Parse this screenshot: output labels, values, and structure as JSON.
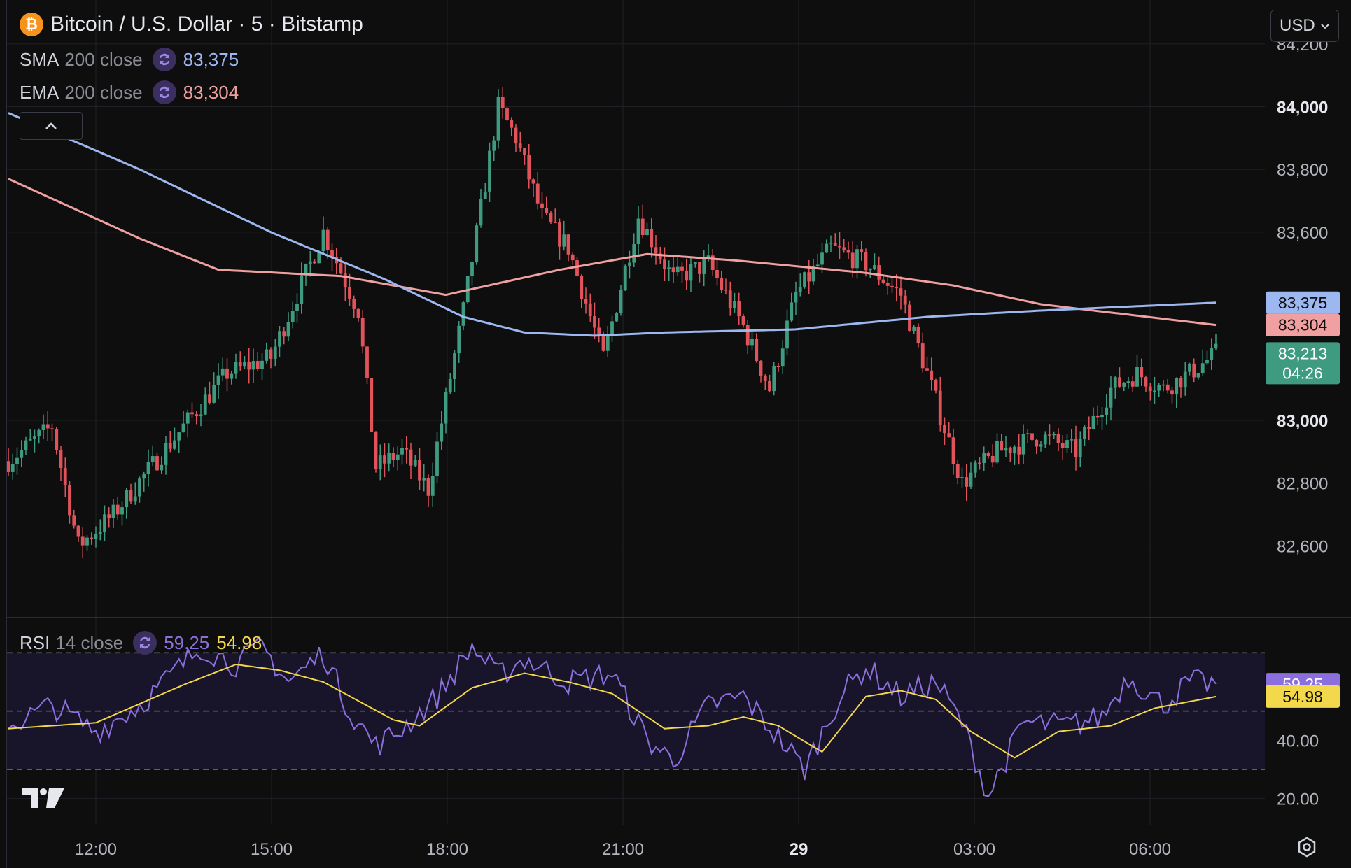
{
  "header": {
    "symbol_title": "Bitcoin / U.S. Dollar · 5 · Bitstamp",
    "btc_icon_glyph": "₿",
    "currency_label": "USD",
    "currency_icon": "chevron-down-icon"
  },
  "indicators": {
    "sma": {
      "name": "SMA",
      "params": "200 close",
      "value": "83,375",
      "color": "#9db8f0"
    },
    "ema": {
      "name": "EMA",
      "params": "200 close",
      "value": "83,304",
      "color": "#f0a0a0"
    },
    "rsi": {
      "name": "RSI",
      "params": "14 close",
      "value": "59.25",
      "ma_value": "54.98",
      "color": "#8b6fdc",
      "ma_color": "#f2d84a"
    }
  },
  "price_axis": {
    "ticks": [
      "84,200",
      "84,000",
      "83,800",
      "83,600",
      "83,000",
      "82,800",
      "82,600"
    ],
    "bold_ticks": [
      "84,000",
      "83,000"
    ],
    "sma_tag": "83,375",
    "ema_tag": "83,304",
    "last_price_tag": "83,213",
    "countdown": "04:26"
  },
  "rsi_axis": {
    "ticks": [
      "40.00",
      "20.00"
    ],
    "rsi_tag": "59.25",
    "ma_tag": "54.98"
  },
  "time_axis": {
    "labels": [
      "12:00",
      "15:00",
      "18:00",
      "21:00",
      "29",
      "03:00",
      "06:00"
    ],
    "bold_labels": [
      "29"
    ]
  },
  "colors": {
    "up": "#3f9b7f",
    "down": "#e0535b",
    "sma": "#9db8f0",
    "ema": "#f0a0a0",
    "rsi": "#8b6fdc",
    "rsi_ma": "#f2d84a",
    "last_price_bg": "#3f9b7f"
  },
  "chart_data": {
    "type": "candlestick",
    "interval": "5",
    "price_range": [
      82400,
      84300
    ],
    "rsi_range": [
      12,
      78
    ],
    "rsi_levels": [
      70,
      50,
      30
    ],
    "time_labels": [
      "12:00",
      "15:00",
      "18:00",
      "21:00",
      "29",
      "03:00",
      "06:00"
    ],
    "close_keypoints": [
      [
        0,
        82870
      ],
      [
        10,
        82980
      ],
      [
        16,
        82600
      ],
      [
        24,
        82700
      ],
      [
        44,
        83050
      ],
      [
        50,
        83150
      ],
      [
        60,
        83200
      ],
      [
        72,
        83600
      ],
      [
        80,
        83350
      ],
      [
        84,
        82850
      ],
      [
        90,
        82900
      ],
      [
        96,
        82780
      ],
      [
        104,
        83350
      ],
      [
        112,
        84000
      ],
      [
        116,
        83900
      ],
      [
        122,
        83650
      ],
      [
        128,
        83550
      ],
      [
        136,
        83200
      ],
      [
        144,
        83650
      ],
      [
        152,
        83450
      ],
      [
        160,
        83500
      ],
      [
        168,
        83300
      ],
      [
        174,
        83100
      ],
      [
        180,
        83400
      ],
      [
        188,
        83550
      ],
      [
        196,
        83500
      ],
      [
        204,
        83400
      ],
      [
        210,
        83150
      ],
      [
        218,
        82800
      ],
      [
        226,
        82900
      ],
      [
        236,
        82950
      ],
      [
        244,
        82900
      ],
      [
        252,
        83100
      ],
      [
        258,
        83150
      ],
      [
        264,
        83100
      ],
      [
        270,
        83150
      ],
      [
        276,
        83213
      ]
    ],
    "sma_keypoints": [
      [
        0,
        83980
      ],
      [
        30,
        83800
      ],
      [
        60,
        83600
      ],
      [
        86,
        83450
      ],
      [
        104,
        83330
      ],
      [
        118,
        83280
      ],
      [
        134,
        83270
      ],
      [
        150,
        83280
      ],
      [
        180,
        83290
      ],
      [
        210,
        83330
      ],
      [
        236,
        83350
      ],
      [
        276,
        83375
      ]
    ],
    "ema_keypoints": [
      [
        0,
        83770
      ],
      [
        30,
        83580
      ],
      [
        48,
        83480
      ],
      [
        76,
        83460
      ],
      [
        100,
        83400
      ],
      [
        126,
        83480
      ],
      [
        146,
        83530
      ],
      [
        166,
        83510
      ],
      [
        196,
        83470
      ],
      [
        216,
        83430
      ],
      [
        236,
        83370
      ],
      [
        276,
        83304
      ]
    ],
    "rsi_keypoints": [
      [
        0,
        45
      ],
      [
        10,
        52
      ],
      [
        20,
        43
      ],
      [
        30,
        52
      ],
      [
        44,
        72
      ],
      [
        52,
        66
      ],
      [
        58,
        72
      ],
      [
        64,
        60
      ],
      [
        72,
        70
      ],
      [
        78,
        50
      ],
      [
        84,
        38
      ],
      [
        90,
        44
      ],
      [
        98,
        55
      ],
      [
        106,
        72
      ],
      [
        112,
        62
      ],
      [
        118,
        68
      ],
      [
        128,
        60
      ],
      [
        138,
        63
      ],
      [
        146,
        40
      ],
      [
        152,
        33
      ],
      [
        160,
        52
      ],
      [
        168,
        55
      ],
      [
        176,
        41
      ],
      [
        182,
        30
      ],
      [
        190,
        55
      ],
      [
        196,
        65
      ],
      [
        204,
        55
      ],
      [
        212,
        60
      ],
      [
        218,
        46
      ],
      [
        224,
        21
      ],
      [
        232,
        46
      ],
      [
        242,
        45
      ],
      [
        250,
        48
      ],
      [
        256,
        62
      ],
      [
        264,
        52
      ],
      [
        270,
        60
      ],
      [
        276,
        59.25
      ]
    ],
    "rsi_ma_keypoints": [
      [
        0,
        44
      ],
      [
        20,
        46
      ],
      [
        40,
        59
      ],
      [
        52,
        66
      ],
      [
        62,
        64
      ],
      [
        72,
        60
      ],
      [
        88,
        47
      ],
      [
        94,
        45
      ],
      [
        106,
        58
      ],
      [
        118,
        63
      ],
      [
        128,
        60
      ],
      [
        138,
        56
      ],
      [
        150,
        44
      ],
      [
        160,
        45
      ],
      [
        168,
        48
      ],
      [
        176,
        45
      ],
      [
        186,
        36
      ],
      [
        196,
        55
      ],
      [
        204,
        57
      ],
      [
        212,
        54
      ],
      [
        220,
        43
      ],
      [
        230,
        34
      ],
      [
        240,
        43
      ],
      [
        252,
        45
      ],
      [
        262,
        51
      ],
      [
        276,
        54.98
      ]
    ]
  }
}
